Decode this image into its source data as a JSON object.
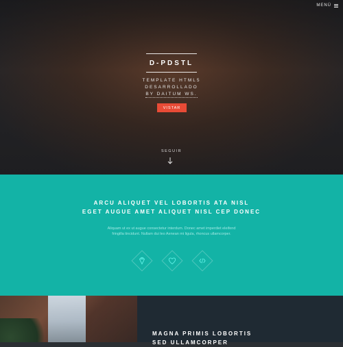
{
  "header": {
    "menu_label": "MENÚ",
    "menu_icon": "hamburger-icon"
  },
  "hero": {
    "logo": "D-PDSTL",
    "tagline_lines": [
      "TEMPLATE HTML5",
      "DESARROLLADO",
      "BY DAITUM WS."
    ],
    "cta_label": "VISTAR",
    "follow_label": "SEGUIR",
    "follow_icon": "arrow-down-icon",
    "cta_color": "#e84b36"
  },
  "features": {
    "headline_lines": [
      "ARCU ALIQUET VEL LOBORTIS ATA NISL",
      "EGET AUGUE AMET ALIQUET NISL CEP DONEC"
    ],
    "sub_lines": [
      "Aliquam ut ex ut augue consectetur interdum. Donec amet imperdiet eleifend",
      "fringilla tincidunt. Nullam dui leo Aenean mi ligula, rhoncus ullamcorper."
    ],
    "icons": [
      "diamond-icon",
      "heart-icon",
      "code-icon"
    ],
    "accent_color": "#13b3a6"
  },
  "bottom": {
    "heading_lines": [
      "MAGNA PRIMIS LOBORTIS",
      "SED ULLAMCORPER"
    ]
  }
}
